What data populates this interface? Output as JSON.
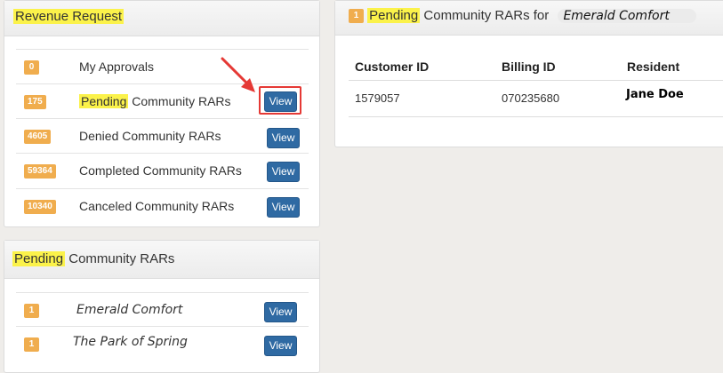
{
  "revenue_panel": {
    "title": "Revenue Request",
    "items": [
      {
        "count": "0",
        "label": "My Approvals"
      },
      {
        "count": "175",
        "label_hl": "Pending",
        "label_rest": " Community RARs",
        "button": "View"
      },
      {
        "count": "4605",
        "label": "Denied Community RARs",
        "button": "View"
      },
      {
        "count": "59364",
        "label": "Completed Community RARs",
        "button": "View"
      },
      {
        "count": "10340",
        "label": "Canceled Community RARs",
        "button": "View"
      }
    ]
  },
  "pending_panel": {
    "title_hl": "Pending",
    "title_rest": " Community RARs",
    "items": [
      {
        "count": "1",
        "name": "Emerald Comfort",
        "button": "View"
      },
      {
        "count": "1",
        "name": "The Park of Spring",
        "button": "View"
      }
    ]
  },
  "detail_panel": {
    "count": "1",
    "title_hl": "Pending",
    "title_rest": " Community RARs for",
    "community": "Emerald Comfort",
    "columns": [
      "Customer ID",
      "Billing ID",
      "Resident"
    ],
    "rows": [
      {
        "customer_id": "1579057",
        "billing_id": "070235680",
        "resident": "Jane Doe"
      }
    ]
  },
  "colors": {
    "highlight": "#fbf24a",
    "badge": "#f0ad4e",
    "button": "#2f6aa3",
    "annotation": "#e53935"
  }
}
